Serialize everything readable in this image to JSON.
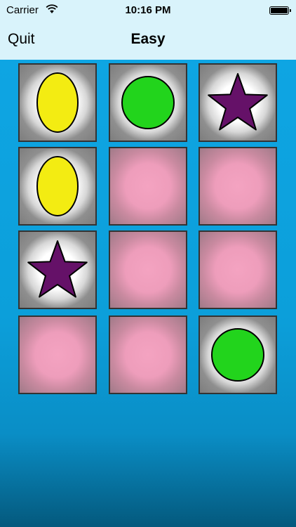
{
  "status_bar": {
    "carrier": "Carrier",
    "time": "10:16 PM",
    "battery_level": 1.0
  },
  "nav": {
    "quit_label": "Quit",
    "title": "Easy"
  },
  "colors": {
    "nav_background": "#d9f3fb",
    "board_background": "#0ea5e3",
    "oval": "#f3ec12",
    "circle": "#22d41c",
    "star": "#651168",
    "hidden_tile": "#f4a3c1"
  },
  "board": {
    "rows": 4,
    "cols": 3,
    "tiles": [
      {
        "state": "revealed",
        "shape": "yellow-oval"
      },
      {
        "state": "revealed",
        "shape": "green-circle"
      },
      {
        "state": "revealed",
        "shape": "purple-star"
      },
      {
        "state": "revealed",
        "shape": "yellow-oval"
      },
      {
        "state": "hidden",
        "shape": ""
      },
      {
        "state": "hidden",
        "shape": ""
      },
      {
        "state": "revealed",
        "shape": "purple-star"
      },
      {
        "state": "hidden",
        "shape": ""
      },
      {
        "state": "hidden",
        "shape": ""
      },
      {
        "state": "hidden",
        "shape": ""
      },
      {
        "state": "hidden",
        "shape": ""
      },
      {
        "state": "revealed",
        "shape": "green-circle"
      }
    ]
  }
}
